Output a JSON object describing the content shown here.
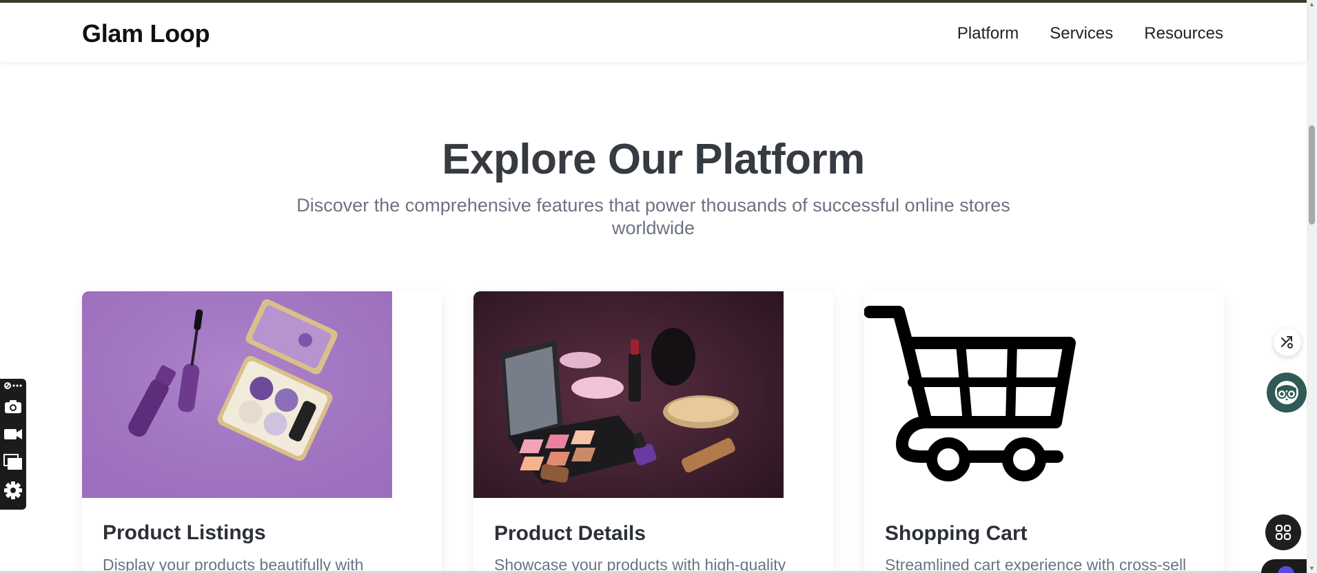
{
  "header": {
    "brand": "Glam Loop",
    "nav": [
      "Platform",
      "Services",
      "Resources"
    ]
  },
  "hero": {
    "title": "Explore Our Platform",
    "subtitle": "Discover the comprehensive features that power thousands of successful online stores worldwide"
  },
  "cards": [
    {
      "title": "Product Listings",
      "description": "Display your products beautifully with",
      "image": "purple-cosmetics-photo"
    },
    {
      "title": "Product Details",
      "description": "Showcase your products with high-quality",
      "image": "makeup-set-photo"
    },
    {
      "title": "Shopping Cart",
      "description": "Streamlined cart experience with cross-sell",
      "image": "shopping-cart-icon"
    }
  ],
  "colors": {
    "heading": "#363a41",
    "muted": "#6b7280",
    "owl_button": "#2f5a55"
  },
  "icons": {
    "left_toolbar": [
      "pen-menu-icon",
      "camera-icon",
      "video-icon",
      "windows-icon",
      "gear-icon"
    ],
    "right_floaters": [
      "share-icon",
      "owl-icon",
      "grid-menu-icon"
    ]
  }
}
